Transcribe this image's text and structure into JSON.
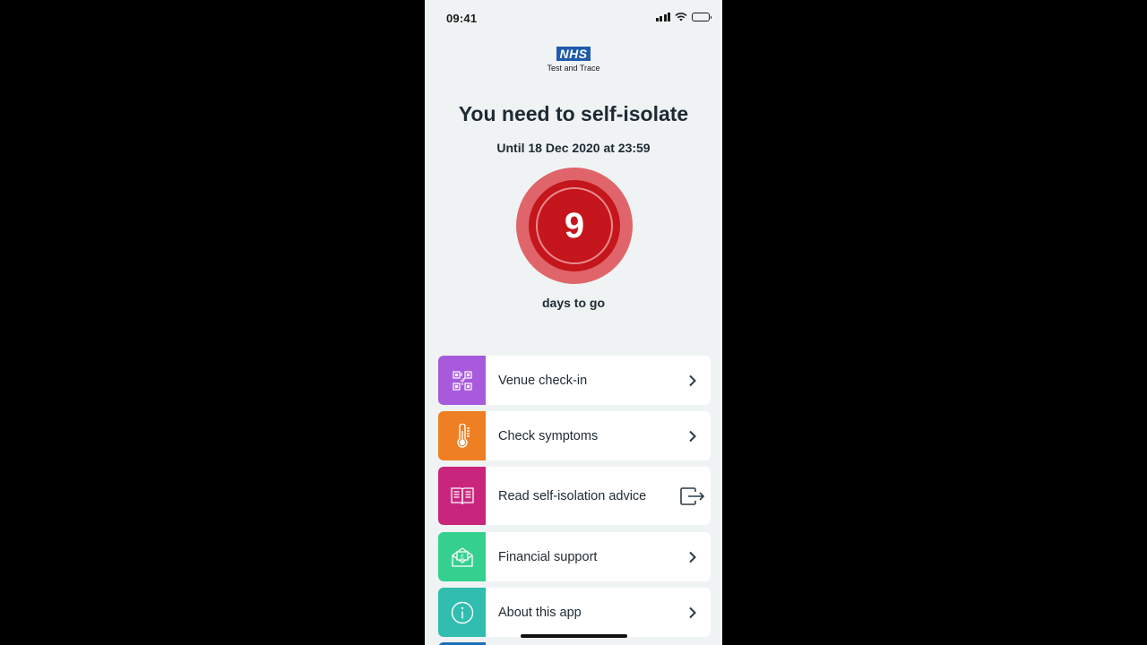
{
  "status_bar": {
    "time": "09:41"
  },
  "logo": {
    "brand": "NHS",
    "subtitle": "Test and Trace"
  },
  "isolation": {
    "headline": "You need to self-isolate",
    "until": "Until 18 Dec 2020 at 23:59",
    "days_remaining": "9",
    "days_label": "days to go"
  },
  "menu": {
    "items": [
      {
        "label": "Venue check-in",
        "color": "#a75bdc",
        "icon": "qr-code-icon",
        "action": "chevron"
      },
      {
        "label": "Check symptoms",
        "color": "#ee7f22",
        "icon": "thermometer-icon",
        "action": "chevron"
      },
      {
        "label": "Read self-isolation advice",
        "color": "#c8267d",
        "icon": "book-icon",
        "action": "external-link"
      },
      {
        "label": "Financial support",
        "color": "#35d08f",
        "icon": "envelope-pound-icon",
        "action": "chevron"
      },
      {
        "label": "About this app",
        "color": "#31bdaf",
        "icon": "info-icon",
        "action": "chevron"
      }
    ]
  },
  "colors": {
    "background": "#f0f3f4",
    "countdown_red": "#c4161c",
    "nhs_blue": "#1f5bab"
  }
}
